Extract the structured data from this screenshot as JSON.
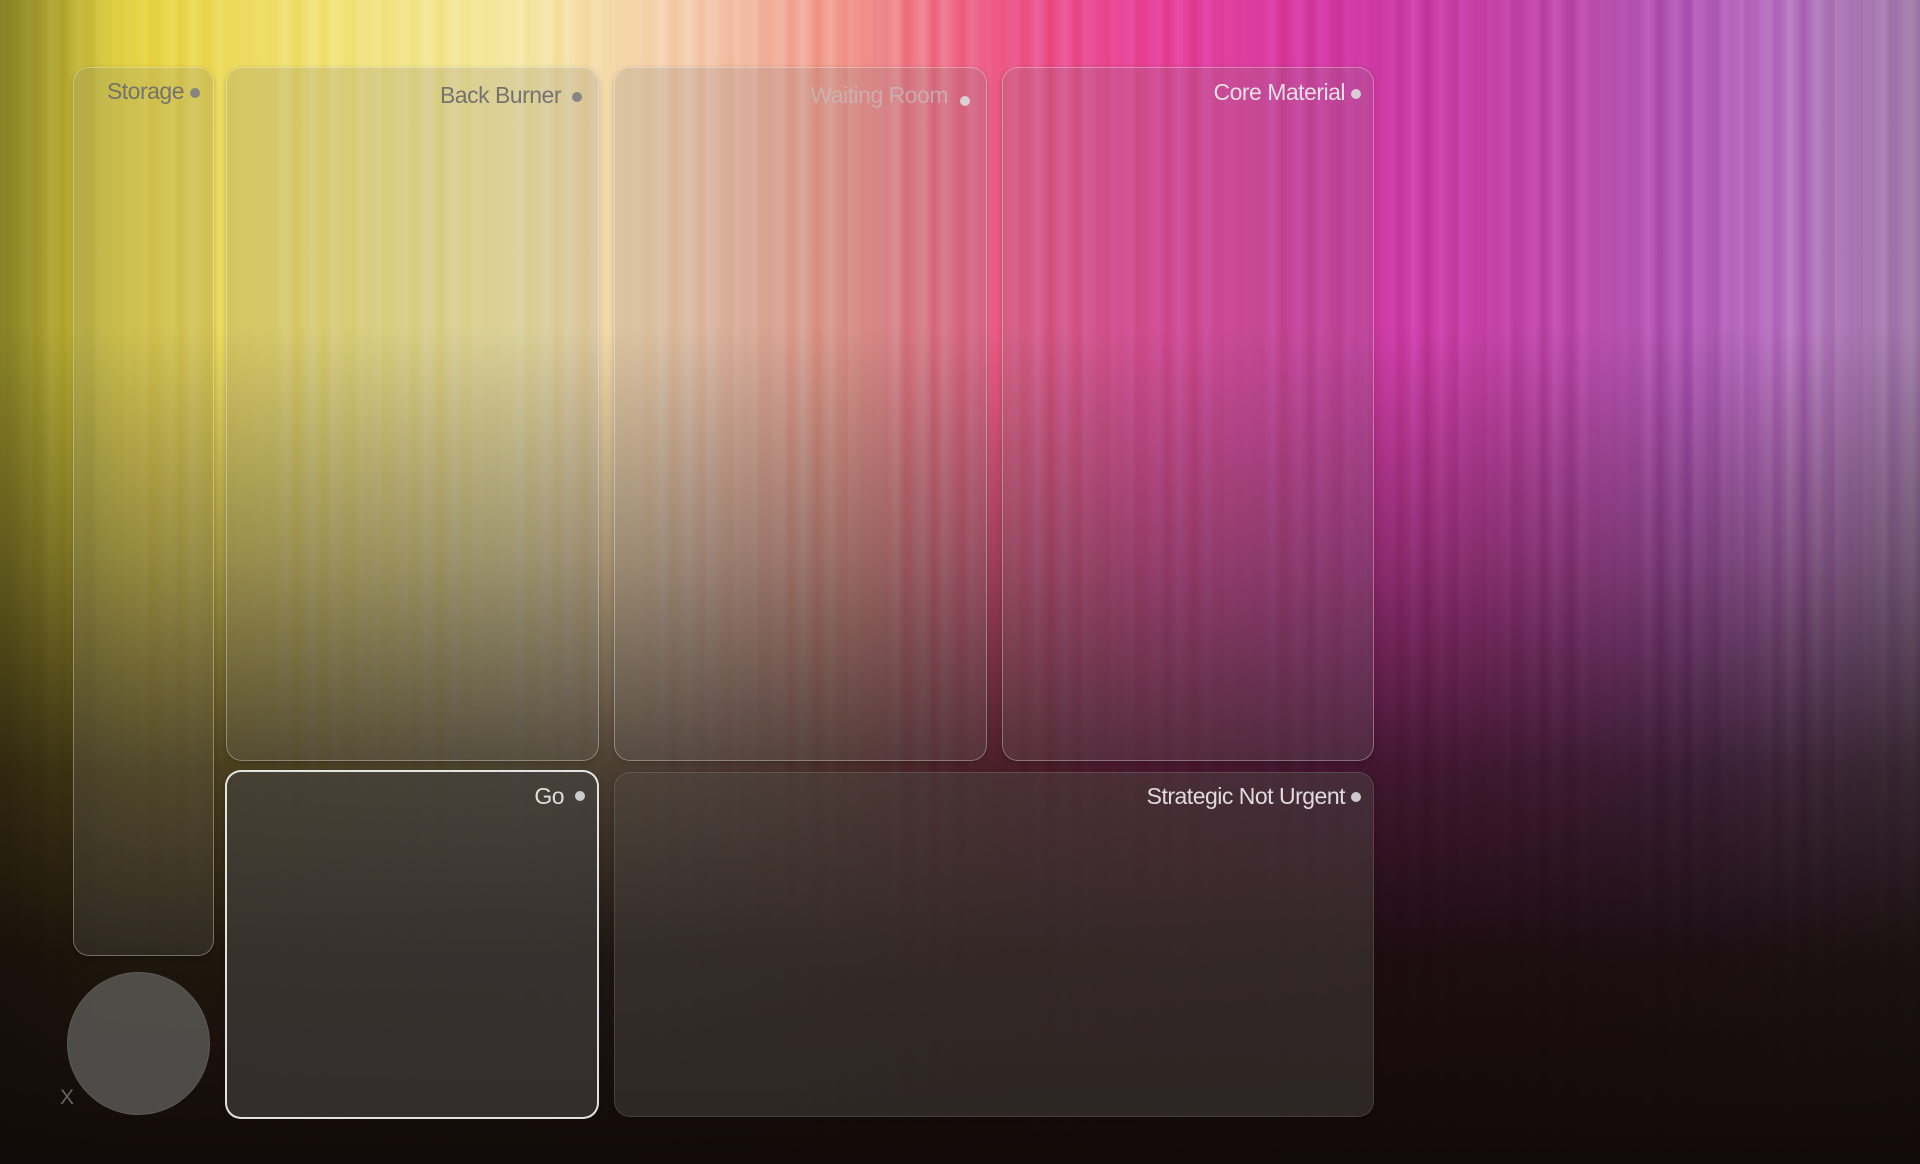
{
  "zones": {
    "storage": {
      "title": "Storage"
    },
    "back_burner": {
      "title": "Back Burner"
    },
    "waiting_room": {
      "title": "Waiting Room"
    },
    "core_material": {
      "title": "Core Material"
    },
    "go": {
      "title": "Go"
    },
    "strategic_not_urgent": {
      "title": "Strategic Not Urgent"
    }
  },
  "controls": {
    "close_glyph": "X"
  },
  "icons": {
    "zone_menu": "dot-icon",
    "trash": "circle",
    "close": "close-icon"
  },
  "colors": {
    "zone_title": "#6e6e6e",
    "zone_title_light": "#ebebeb",
    "go_border": "#f5f5f5"
  }
}
